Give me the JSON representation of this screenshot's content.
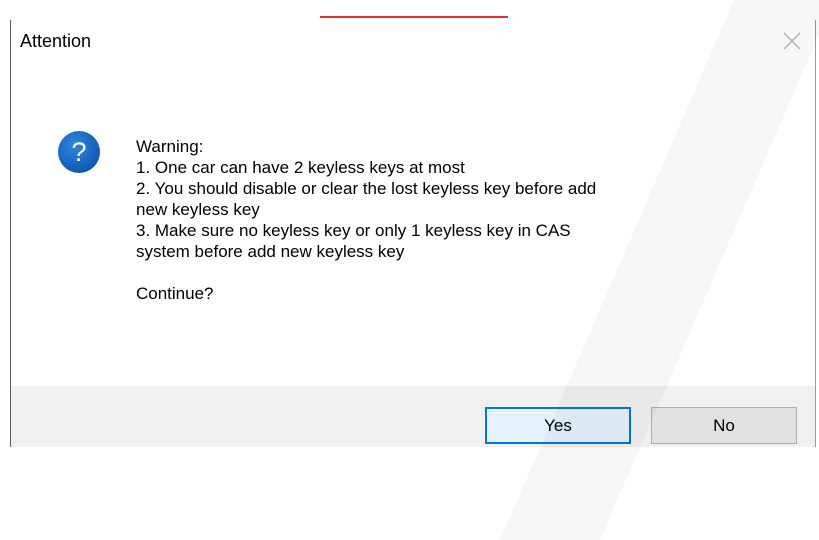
{
  "dialog": {
    "title": "Attention",
    "close_icon": "close-icon",
    "icon": "question-icon",
    "icon_glyph": "?",
    "message_lines": [
      "Warning:",
      "1. One car can have 2 keyless keys at most",
      "2. You should disable or clear the lost keyless key before add",
      "new keyless key",
      "3. Make sure no keyless key or only 1 keyless key in CAS",
      "system before add new keyless key"
    ],
    "prompt": "Continue?",
    "buttons": {
      "yes_label": "Yes",
      "no_label": "No"
    }
  },
  "colors": {
    "icon_blue": "#1565c0",
    "focus_border": "#0078d7",
    "footer_bg": "#f0f0f0",
    "accent_red": "#e0312b"
  }
}
